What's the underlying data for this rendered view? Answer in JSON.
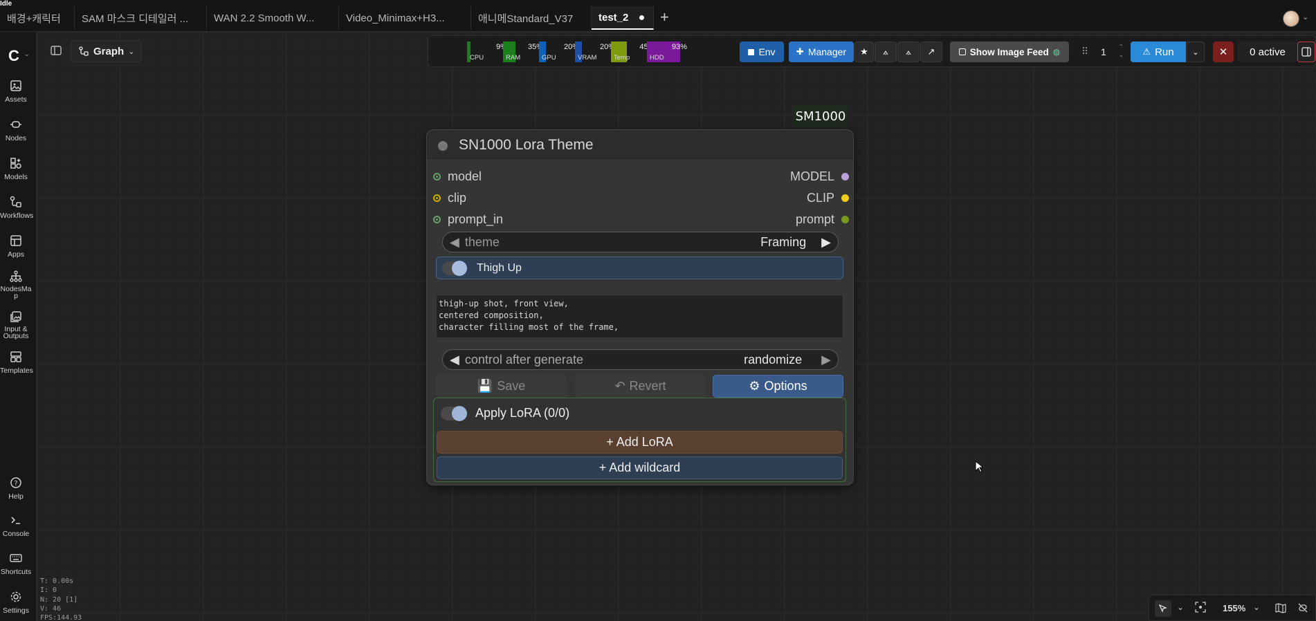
{
  "app": {
    "corner_label": "Idle"
  },
  "tabs": [
    {
      "label": "배경+캐릭터"
    },
    {
      "label": "SAM 마스크 디테일러 ..."
    },
    {
      "label": "WAN 2.2 Smooth W..."
    },
    {
      "label": "Video_Minimax+H3..."
    },
    {
      "label": "애니메Standard_V37"
    },
    {
      "label": "test_2",
      "active": true
    }
  ],
  "sidebar": {
    "items": [
      {
        "label": "Assets",
        "icon": "image-icon"
      },
      {
        "label": "Nodes",
        "icon": "node-icon"
      },
      {
        "label": "Models",
        "icon": "models-icon"
      },
      {
        "label": "Workflows",
        "icon": "workflow-icon"
      },
      {
        "label": "Apps",
        "icon": "apps-icon"
      },
      {
        "label": "NodesMa\np",
        "icon": "nodesmap-icon"
      },
      {
        "label": "Input &\nOutputs",
        "icon": "io-icon"
      },
      {
        "label": "Templates",
        "icon": "templates-icon"
      }
    ],
    "bottom": [
      {
        "label": "Help",
        "icon": "help-icon"
      },
      {
        "label": "Console",
        "icon": "console-icon"
      },
      {
        "label": "Shortcuts",
        "icon": "keyboard-icon"
      },
      {
        "label": "Settings",
        "icon": "gear-icon"
      }
    ]
  },
  "stats": {
    "t": "T: 0.00s",
    "i": "I: 0",
    "n": "N: 20 [1]",
    "v": "V: 46",
    "fps": "FPS:144.93"
  },
  "graph": {
    "label": "Graph"
  },
  "monitors": [
    {
      "name": "CPU",
      "pct": "9%",
      "value": 0.09,
      "color": "#1a7f1a"
    },
    {
      "name": "RAM",
      "pct": "35%",
      "value": 0.35,
      "color": "#1a7f1a"
    },
    {
      "name": "GPU",
      "pct": "20%",
      "value": 0.2,
      "color": "#0d62b8"
    },
    {
      "name": "VRAM",
      "pct": "20%",
      "value": 0.2,
      "color": "#1d4fa6"
    },
    {
      "name": "Temp",
      "pct": "45°",
      "value": 0.45,
      "color": "#7f9a0d"
    },
    {
      "name": "HDD",
      "pct": "93%",
      "value": 0.93,
      "color": "#7a1a9a"
    }
  ],
  "toolbar": {
    "env_label": "Env",
    "manager_label": "Manager",
    "image_feed_label": "Show Image Feed",
    "queue_count": "1",
    "run_label": "Run",
    "active_label": "0 active",
    "colors": {
      "env": "#1f5fa8",
      "manager": "#2b73c7",
      "run": "#2b8ad8",
      "cancel": "#7a1e1e"
    }
  },
  "node": {
    "badge": "SM1000",
    "title": "SN1000 Lora Theme",
    "inputs": [
      {
        "label": "model",
        "color": "#6aa06a"
      },
      {
        "label": "clip",
        "color": "#c8b000"
      },
      {
        "label": "prompt_in",
        "color": "#6aa06a"
      }
    ],
    "outputs": [
      {
        "label": "MODEL",
        "color": "#b8a2d8"
      },
      {
        "label": "CLIP",
        "color": "#f2cc1b"
      },
      {
        "label": "prompt",
        "color": "#7a9a1e"
      }
    ],
    "theme_widget": {
      "label": "theme",
      "value": "Framing"
    },
    "toggle": {
      "label": "Thigh Up",
      "on": true
    },
    "prompt_text": "thigh-up shot, front view,\ncentered composition,\ncharacter filling most of the frame,",
    "control_widget": {
      "label": "control after generate",
      "value": "randomize"
    },
    "buttons": {
      "save": "Save",
      "revert": "Revert",
      "options": "Options"
    },
    "lora": {
      "apply_label": "Apply LoRA  (0/0)",
      "add_lora": "+ Add LoRA",
      "add_wildcard": "+ Add wildcard"
    }
  },
  "canvas_controls": {
    "zoom": "155%"
  }
}
